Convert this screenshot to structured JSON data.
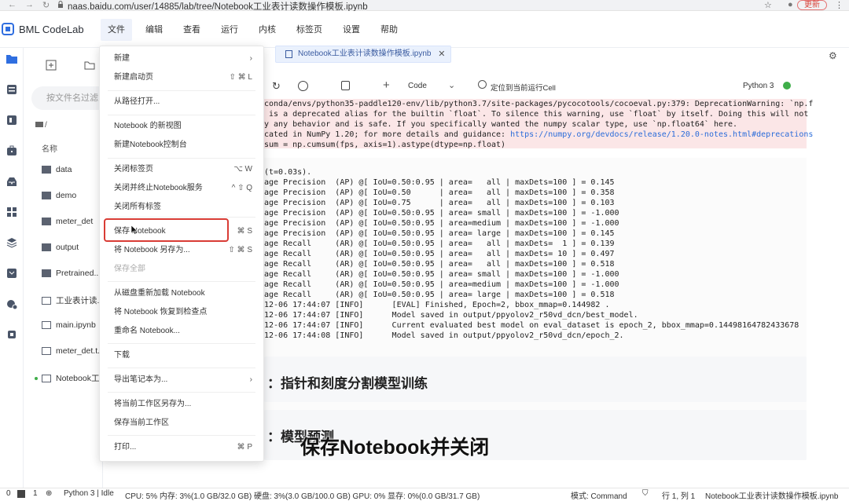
{
  "browser": {
    "url": "naas.baidu.com/user/14885/lab/tree/Notebook工业表计读数操作模板.ipynb",
    "update_label": "更新"
  },
  "app": {
    "brand": "BML CodeLab",
    "menus": [
      "文件",
      "编辑",
      "查看",
      "运行",
      "内核",
      "标签页",
      "设置",
      "帮助"
    ]
  },
  "file_browser": {
    "search_placeholder": "按文件名过滤",
    "path": "/",
    "column_name": "名称",
    "items": [
      {
        "name": "data",
        "type": "folder"
      },
      {
        "name": "demo",
        "type": "folder"
      },
      {
        "name": "meter_det",
        "type": "folder"
      },
      {
        "name": "output",
        "type": "folder"
      },
      {
        "name": "Pretrained...",
        "type": "folder"
      },
      {
        "name": "工业表计读...",
        "type": "notebook"
      },
      {
        "name": "main.ipynb",
        "type": "notebook"
      },
      {
        "name": "meter_det.t...",
        "type": "text"
      },
      {
        "name": "Notebook工...",
        "type": "notebook"
      }
    ]
  },
  "file_menu": {
    "items": [
      {
        "label": "新建",
        "shortcut": "›"
      },
      {
        "label": "新建启动页",
        "shortcut": "⇧ ⌘ L"
      },
      {
        "label": "从路径打开...",
        "shortcut": ""
      },
      {
        "label": "Notebook 的新视图",
        "shortcut": ""
      },
      {
        "label": "新建Notebook控制台",
        "shortcut": ""
      },
      {
        "label": "关闭标签页",
        "shortcut": "⌥ W"
      },
      {
        "label": "关闭并终止Notebook服务",
        "shortcut": "^ ⇧ Q"
      },
      {
        "label": "关闭所有标签",
        "shortcut": ""
      },
      {
        "label": "保存 Notebook",
        "shortcut": "⌘ S"
      },
      {
        "label": "将 Notebook 另存为...",
        "shortcut": "⇧ ⌘ S"
      },
      {
        "label": "保存全部",
        "shortcut": ""
      },
      {
        "label": "从磁盘重新加载 Notebook",
        "shortcut": ""
      },
      {
        "label": "将 Notebook 恢复到检查点",
        "shortcut": ""
      },
      {
        "label": "重命名 Notebook...",
        "shortcut": ""
      },
      {
        "label": "下载",
        "shortcut": ""
      },
      {
        "label": "导出笔记本为...",
        "shortcut": "›"
      },
      {
        "label": "将当前工作区另存为...",
        "shortcut": ""
      },
      {
        "label": "保存当前工作区",
        "shortcut": ""
      },
      {
        "label": "打印...",
        "shortcut": "⌘ P"
      }
    ]
  },
  "notebook": {
    "tab_title": "Notebook工业表计读数操作模板.ipynb",
    "toolbar": {
      "cell_type": "Code",
      "locate_label": "定位到当前运行Cell",
      "kernel": "Python 3"
    },
    "warning_lines": [
      "conda/envs/python35-paddle120-env/lib/python3.7/site-packages/pycocotools/cocoeval.py:379: DeprecationWarning: `np.f",
      " is a deprecated alias for the builtin `float`. To silence this warning, use `float` by itself. Doing this will not",
      "y any behavior and is safe. If you specifically wanted the numpy scalar type, use `np.float64` here.",
      "cated in NumPy 1.20; for more details and guidance: ",
      "sum = np.cumsum(fps, axis=1).astype(dtype=np.float)"
    ],
    "warning_link": "https://numpy.org/devdocs/release/1.20.0-notes.html#deprecations",
    "output_lines": [
      "(t=0.03s).",
      "age Precision  (AP) @[ IoU=0.50:0.95 | area=   all | maxDets=100 ] = 0.145",
      "age Precision  (AP) @[ IoU=0.50      | area=   all | maxDets=100 ] = 0.358",
      "age Precision  (AP) @[ IoU=0.75      | area=   all | maxDets=100 ] = 0.103",
      "age Precision  (AP) @[ IoU=0.50:0.95 | area= small | maxDets=100 ] = -1.000",
      "age Precision  (AP) @[ IoU=0.50:0.95 | area=medium | maxDets=100 ] = -1.000",
      "age Precision  (AP) @[ IoU=0.50:0.95 | area= large | maxDets=100 ] = 0.145",
      "age Recall     (AR) @[ IoU=0.50:0.95 | area=   all | maxDets=  1 ] = 0.139",
      "age Recall     (AR) @[ IoU=0.50:0.95 | area=   all | maxDets= 10 ] = 0.497",
      "age Recall     (AR) @[ IoU=0.50:0.95 | area=   all | maxDets=100 ] = 0.518",
      "age Recall     (AR) @[ IoU=0.50:0.95 | area= small | maxDets=100 ] = -1.000",
      "age Recall     (AR) @[ IoU=0.50:0.95 | area=medium | maxDets=100 ] = -1.000",
      "age Recall     (AR) @[ IoU=0.50:0.95 | area= large | maxDets=100 ] = 0.518",
      "12-06 17:44:07 [INFO]      [EVAL] Finished, Epoch=2, bbox_mmap=0.144982 .",
      "12-06 17:44:07 [INFO]      Model saved in output/ppyolov2_r50vd_dcn/best_model.",
      "12-06 17:44:07 [INFO]      Current evaluated best model on eval_dataset is epoch_2, bbox_mmap=0.14498164782433678",
      "12-06 17:44:08 [INFO]      Model saved in output/ppyolov2_r50vd_dcn/epoch_2."
    ],
    "md_heading_1": "：指针和刻度分割模型训练",
    "md_heading_2": "：模型预测"
  },
  "subtitle": "保存Notebook并关闭",
  "status_bar": {
    "left_a": "0",
    "left_b": "1",
    "kernel_status": "Python 3 | Idle",
    "resources": "CPU:  5% 内存: 3%(1.0 GB/32.0 GB) 硬盘: 3%(3.0 GB/100.0 GB) GPU:  0%  显存: 0%(0.0 GB/31.7 GB)",
    "mode": "模式: Command",
    "cursor": "行 1, 列 1",
    "filename": "Notebook工业表计读数操作模板.ipynb"
  },
  "colors": {
    "accent": "#2b6cd9",
    "highlight_border": "#d93c35",
    "warning_bg": "#fbe6e7",
    "kernel_idle": "#3fae49"
  }
}
